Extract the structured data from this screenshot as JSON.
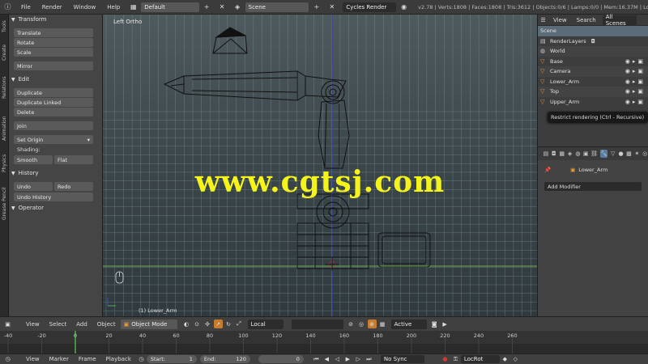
{
  "topbar": {
    "menus": [
      "File",
      "Render",
      "Window",
      "Help"
    ],
    "layout": "Default",
    "scene": "Scene",
    "engine": "Cycles Render",
    "stats": "v2.78 | Verts:1808 | Faces:1808 | Tris:3612 | Objects:0/6 | Lamps:0/0 | Mem:16.37M | Lower_A"
  },
  "tabs": [
    "Tools",
    "Create",
    "Relations",
    "Animation",
    "Physics",
    "Grease Pencil"
  ],
  "tools": {
    "transform": {
      "title": "Transform",
      "buttons": [
        "Translate",
        "Rotate",
        "Scale",
        "Mirror"
      ]
    },
    "edit": {
      "title": "Edit",
      "buttons": [
        "Duplicate",
        "Duplicate Linked",
        "Delete",
        "Join",
        "Set Origin"
      ]
    },
    "shading": {
      "title": "Shading:",
      "smooth": "Smooth",
      "flat": "Flat"
    },
    "history": {
      "title": "History",
      "undo": "Undo",
      "redo": "Redo",
      "undo_history": "Undo History"
    },
    "operator": "Operator"
  },
  "viewport": {
    "label": "Left Ortho",
    "object_label": "(1) Lower_Arm",
    "watermark": "www.cgtsj.com"
  },
  "outliner": {
    "menus": [
      "View",
      "Search",
      "All Scenes"
    ],
    "items": [
      {
        "name": "Scene",
        "icon": "scene-icon"
      },
      {
        "name": "RenderLayers",
        "icon": "render-layers-icon"
      },
      {
        "name": "World",
        "icon": "world-icon"
      },
      {
        "name": "Base",
        "icon": "mesh-icon"
      },
      {
        "name": "Camera",
        "icon": "camera-icon"
      },
      {
        "name": "Lower_Arm",
        "icon": "mesh-icon"
      },
      {
        "name": "Top",
        "icon": "mesh-icon"
      },
      {
        "name": "Upper_Arm",
        "icon": "mesh-icon"
      }
    ],
    "tooltip": "Restrict rendering (Ctrl - Recursive)"
  },
  "properties": {
    "object_name": "Lower_Arm",
    "add_modifier": "Add Modifier"
  },
  "view_header": {
    "menus": [
      "View",
      "Select",
      "Add",
      "Object"
    ],
    "mode": "Object Mode",
    "pivot": "Local",
    "snap": "Active"
  },
  "timeline": {
    "ticks": [
      "-40",
      "-20",
      "0",
      "20",
      "40",
      "60",
      "80",
      "100",
      "120",
      "140",
      "160",
      "180",
      "200",
      "220",
      "240",
      "260"
    ],
    "current_frame": 0
  },
  "timeline_header": {
    "menus": [
      "View",
      "Marker",
      "Frame",
      "Playback"
    ],
    "start_label": "Start:",
    "start": "1",
    "end_label": "End:",
    "end": "120",
    "current": "0",
    "sync": "No Sync",
    "keying_set": "LocRot"
  },
  "colors": {
    "accent": "#5b7aa6",
    "object_orange": "#e69a3a",
    "watermark": "#f4f41a",
    "grid": "#8aa0a6"
  }
}
